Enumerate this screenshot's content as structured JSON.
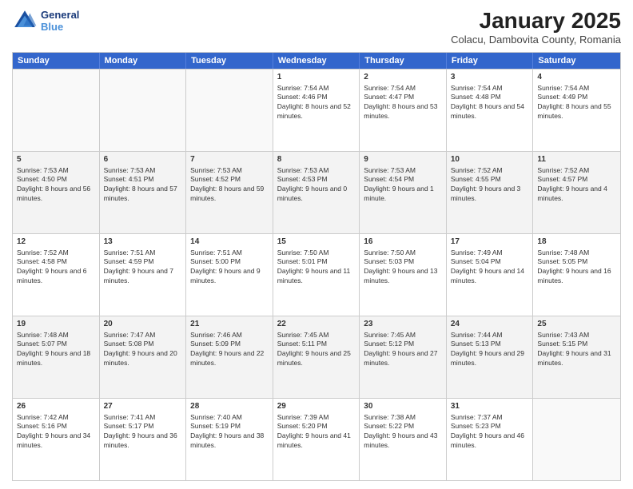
{
  "header": {
    "logo_line1": "General",
    "logo_line2": "Blue",
    "month": "January 2025",
    "location": "Colacu, Dambovita County, Romania"
  },
  "weekdays": [
    "Sunday",
    "Monday",
    "Tuesday",
    "Wednesday",
    "Thursday",
    "Friday",
    "Saturday"
  ],
  "rows": [
    [
      {
        "day": "",
        "text": "",
        "empty": true
      },
      {
        "day": "",
        "text": "",
        "empty": true
      },
      {
        "day": "",
        "text": "",
        "empty": true
      },
      {
        "day": "1",
        "text": "Sunrise: 7:54 AM\nSunset: 4:46 PM\nDaylight: 8 hours and 52 minutes."
      },
      {
        "day": "2",
        "text": "Sunrise: 7:54 AM\nSunset: 4:47 PM\nDaylight: 8 hours and 53 minutes."
      },
      {
        "day": "3",
        "text": "Sunrise: 7:54 AM\nSunset: 4:48 PM\nDaylight: 8 hours and 54 minutes."
      },
      {
        "day": "4",
        "text": "Sunrise: 7:54 AM\nSunset: 4:49 PM\nDaylight: 8 hours and 55 minutes."
      }
    ],
    [
      {
        "day": "5",
        "text": "Sunrise: 7:53 AM\nSunset: 4:50 PM\nDaylight: 8 hours and 56 minutes."
      },
      {
        "day": "6",
        "text": "Sunrise: 7:53 AM\nSunset: 4:51 PM\nDaylight: 8 hours and 57 minutes."
      },
      {
        "day": "7",
        "text": "Sunrise: 7:53 AM\nSunset: 4:52 PM\nDaylight: 8 hours and 59 minutes."
      },
      {
        "day": "8",
        "text": "Sunrise: 7:53 AM\nSunset: 4:53 PM\nDaylight: 9 hours and 0 minutes."
      },
      {
        "day": "9",
        "text": "Sunrise: 7:53 AM\nSunset: 4:54 PM\nDaylight: 9 hours and 1 minute."
      },
      {
        "day": "10",
        "text": "Sunrise: 7:52 AM\nSunset: 4:55 PM\nDaylight: 9 hours and 3 minutes."
      },
      {
        "day": "11",
        "text": "Sunrise: 7:52 AM\nSunset: 4:57 PM\nDaylight: 9 hours and 4 minutes."
      }
    ],
    [
      {
        "day": "12",
        "text": "Sunrise: 7:52 AM\nSunset: 4:58 PM\nDaylight: 9 hours and 6 minutes."
      },
      {
        "day": "13",
        "text": "Sunrise: 7:51 AM\nSunset: 4:59 PM\nDaylight: 9 hours and 7 minutes."
      },
      {
        "day": "14",
        "text": "Sunrise: 7:51 AM\nSunset: 5:00 PM\nDaylight: 9 hours and 9 minutes."
      },
      {
        "day": "15",
        "text": "Sunrise: 7:50 AM\nSunset: 5:01 PM\nDaylight: 9 hours and 11 minutes."
      },
      {
        "day": "16",
        "text": "Sunrise: 7:50 AM\nSunset: 5:03 PM\nDaylight: 9 hours and 13 minutes."
      },
      {
        "day": "17",
        "text": "Sunrise: 7:49 AM\nSunset: 5:04 PM\nDaylight: 9 hours and 14 minutes."
      },
      {
        "day": "18",
        "text": "Sunrise: 7:48 AM\nSunset: 5:05 PM\nDaylight: 9 hours and 16 minutes."
      }
    ],
    [
      {
        "day": "19",
        "text": "Sunrise: 7:48 AM\nSunset: 5:07 PM\nDaylight: 9 hours and 18 minutes."
      },
      {
        "day": "20",
        "text": "Sunrise: 7:47 AM\nSunset: 5:08 PM\nDaylight: 9 hours and 20 minutes."
      },
      {
        "day": "21",
        "text": "Sunrise: 7:46 AM\nSunset: 5:09 PM\nDaylight: 9 hours and 22 minutes."
      },
      {
        "day": "22",
        "text": "Sunrise: 7:45 AM\nSunset: 5:11 PM\nDaylight: 9 hours and 25 minutes."
      },
      {
        "day": "23",
        "text": "Sunrise: 7:45 AM\nSunset: 5:12 PM\nDaylight: 9 hours and 27 minutes."
      },
      {
        "day": "24",
        "text": "Sunrise: 7:44 AM\nSunset: 5:13 PM\nDaylight: 9 hours and 29 minutes."
      },
      {
        "day": "25",
        "text": "Sunrise: 7:43 AM\nSunset: 5:15 PM\nDaylight: 9 hours and 31 minutes."
      }
    ],
    [
      {
        "day": "26",
        "text": "Sunrise: 7:42 AM\nSunset: 5:16 PM\nDaylight: 9 hours and 34 minutes."
      },
      {
        "day": "27",
        "text": "Sunrise: 7:41 AM\nSunset: 5:17 PM\nDaylight: 9 hours and 36 minutes."
      },
      {
        "day": "28",
        "text": "Sunrise: 7:40 AM\nSunset: 5:19 PM\nDaylight: 9 hours and 38 minutes."
      },
      {
        "day": "29",
        "text": "Sunrise: 7:39 AM\nSunset: 5:20 PM\nDaylight: 9 hours and 41 minutes."
      },
      {
        "day": "30",
        "text": "Sunrise: 7:38 AM\nSunset: 5:22 PM\nDaylight: 9 hours and 43 minutes."
      },
      {
        "day": "31",
        "text": "Sunrise: 7:37 AM\nSunset: 5:23 PM\nDaylight: 9 hours and 46 minutes."
      },
      {
        "day": "",
        "text": "",
        "empty": true
      }
    ]
  ]
}
